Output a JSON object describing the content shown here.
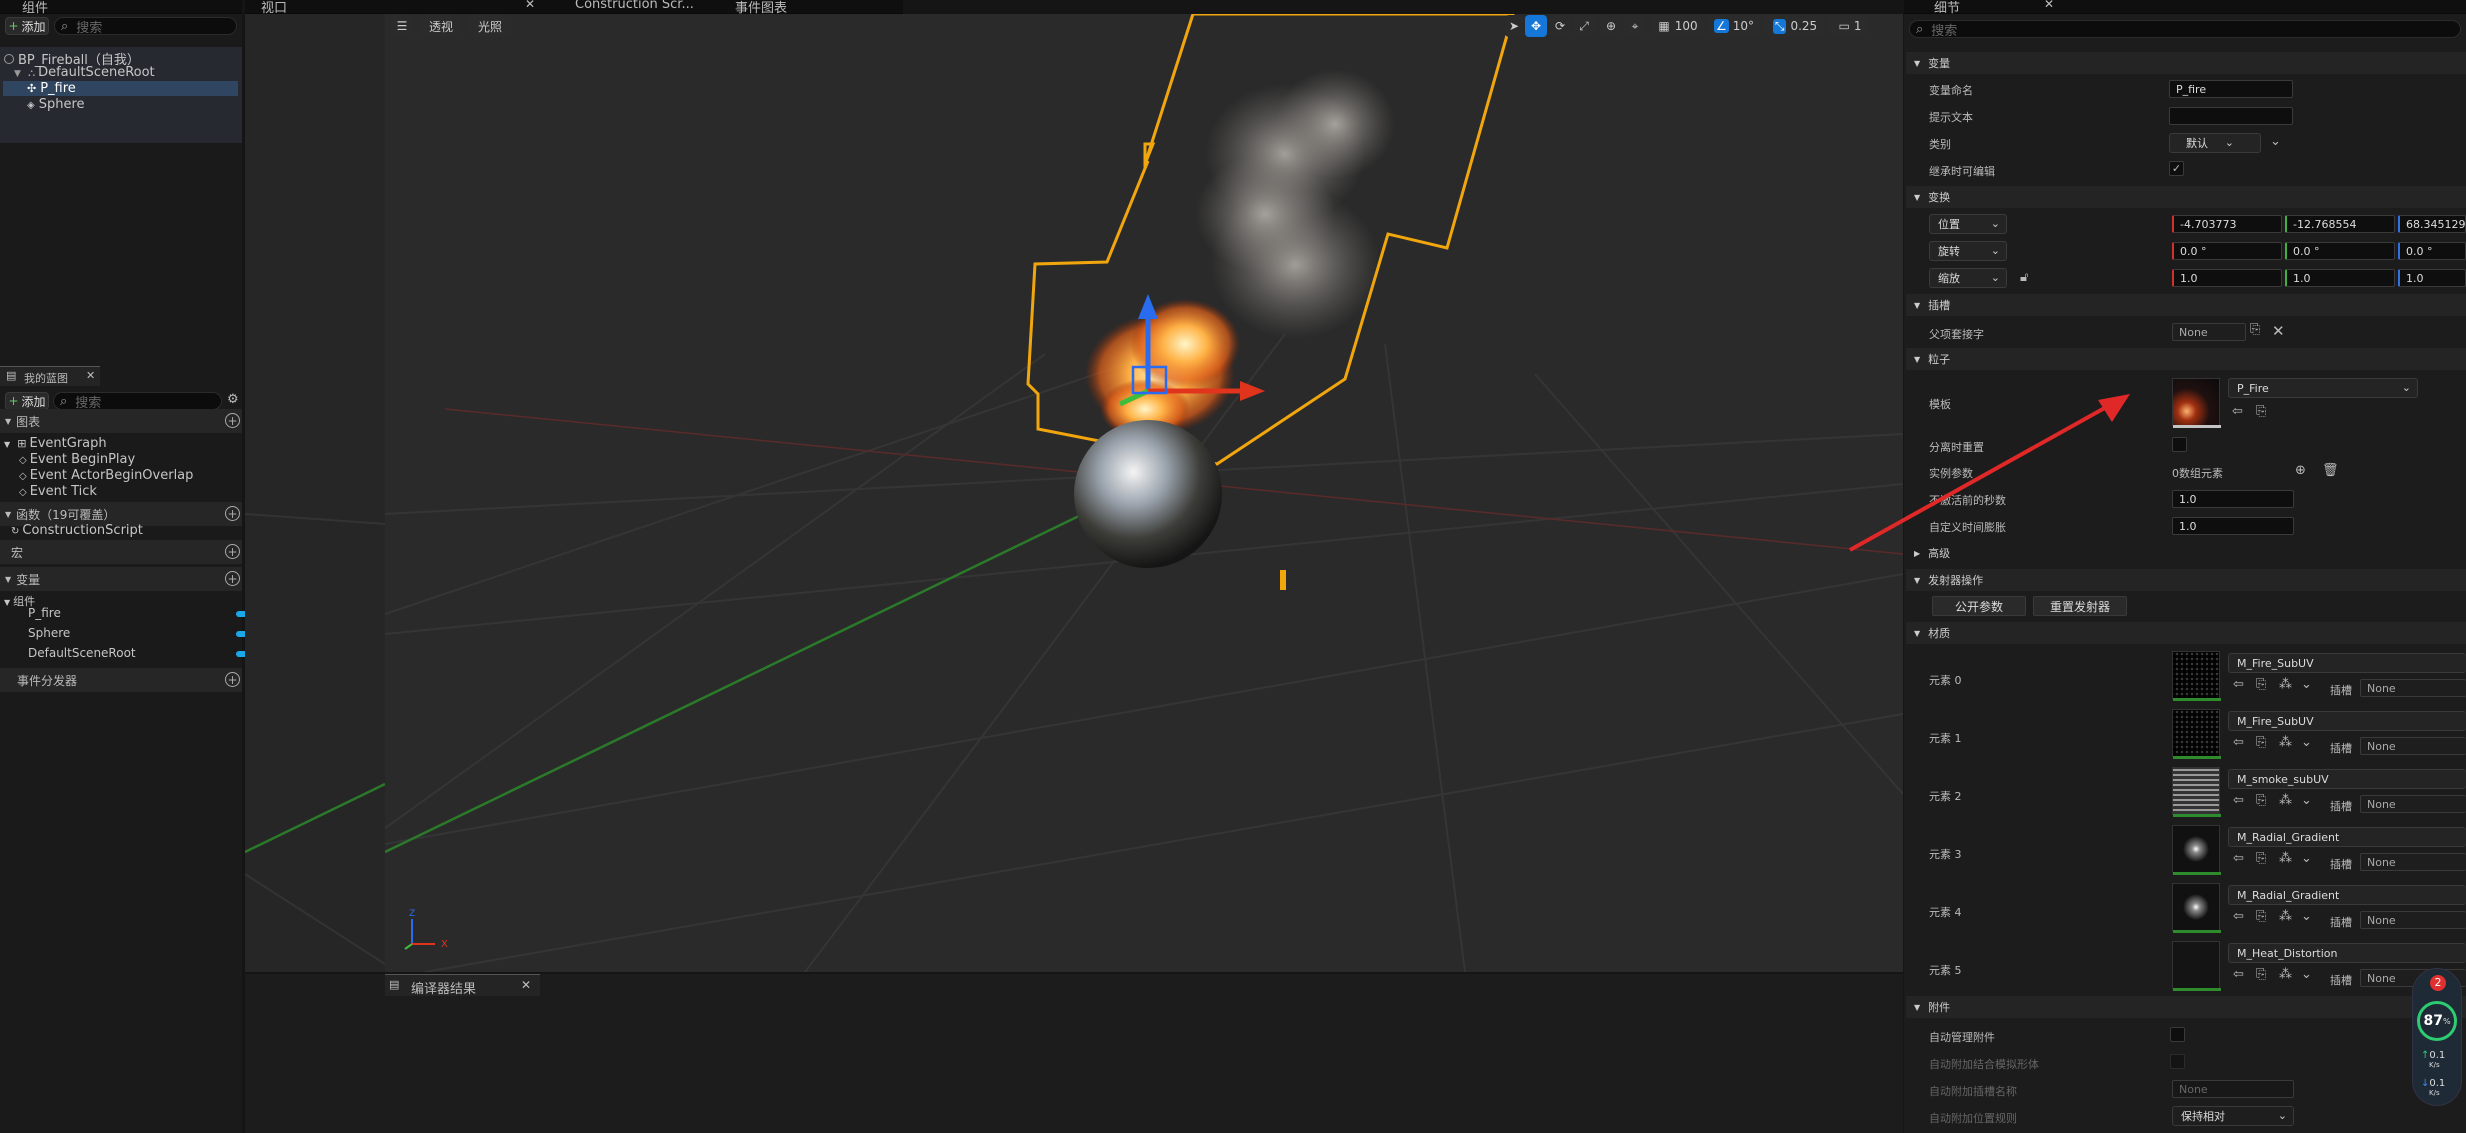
{
  "components_panel": {
    "tab": "组件",
    "add_label": "添加",
    "search_placeholder": "搜索",
    "tree": [
      {
        "label": "BP_Fireball（自我）"
      },
      {
        "label": "DefaultSceneRoot"
      },
      {
        "label": "P_fire"
      },
      {
        "label": "Sphere"
      }
    ]
  },
  "viewport": {
    "tabs": [
      "视口",
      "Construction Scr...",
      "事件图表"
    ],
    "btn_perspective": "透视",
    "btn_lit": "光照",
    "grid_snap": "100",
    "rot_snap": "10°",
    "scale_snap": "0.25",
    "camera_speed": "1",
    "axis_x": "X",
    "axis_z": "Z"
  },
  "my_blueprint": {
    "tab": "我的蓝图",
    "add_label": "添加",
    "search_placeholder": "搜索",
    "graphs_header": "图表",
    "event_graph": "EventGraph",
    "events": [
      "Event BeginPlay",
      "Event ActorBeginOverlap",
      "Event Tick"
    ],
    "functions_header": "函数（19可覆盖）",
    "construction_script": "ConstructionScript",
    "macros_header": "宏",
    "variables_header": "变量",
    "components_sub": "组件",
    "variables": [
      "P_fire",
      "Sphere",
      "DefaultSceneRoot"
    ],
    "dispatchers_header": "事件分发器"
  },
  "compiler": {
    "tab": "编译器结果"
  },
  "details": {
    "tab": "细节",
    "search_placeholder": "搜索",
    "sec_variable": "变量",
    "var_name_label": "变量命名",
    "var_name_value": "P_fire",
    "tooltip_label": "提示文本",
    "category_label": "类别",
    "category_value": "默认",
    "editable_label": "继承时可编辑",
    "sec_transform": "变换",
    "location_label": "位置",
    "location": [
      "-4.703773",
      "-12.768554",
      "68.345129"
    ],
    "rotation_label": "旋转",
    "rotation": [
      "0.0 °",
      "0.0 °",
      "0.0 °"
    ],
    "scale_label": "缩放",
    "scale": [
      "1.0",
      "1.0",
      "1.0"
    ],
    "sec_sockets": "插槽",
    "parent_socket_label": "父项套接字",
    "parent_socket_value": "None",
    "sec_particles": "粒子",
    "template_label": "模板",
    "template_value": "P_Fire",
    "reset_detach_label": "分离时重置",
    "instance_params_label": "实例参数",
    "instance_params_value": "0数组元素",
    "secs_before_inactive_label": "不激活前的秒数",
    "secs_before_inactive_value": "1.0",
    "custom_time_dilation_label": "自定义时间膨胀",
    "custom_time_dilation_value": "1.0",
    "sec_advanced": "高级",
    "sec_emitter_ops": "发射器操作",
    "btn_expose_params": "公开参数",
    "btn_reset_emitters": "重置发射器",
    "sec_materials": "材质",
    "slot_label": "插槽",
    "slot_value": "None",
    "materials": [
      {
        "label": "元素 0",
        "value": "M_Fire_SubUV"
      },
      {
        "label": "元素 1",
        "value": "M_Fire_SubUV"
      },
      {
        "label": "元素 2",
        "value": "M_smoke_subUV"
      },
      {
        "label": "元素 3",
        "value": "M_Radial_Gradient"
      },
      {
        "label": "元素 4",
        "value": "M_Radial_Gradient"
      },
      {
        "label": "元素 5",
        "value": "M_Heat_Distortion"
      }
    ],
    "sec_attachment": "附件",
    "auto_manage_attach_label": "自动管理附件",
    "auto_attach_sim_label": "自动附加结合模拟形体",
    "auto_attach_socket_label": "自动附加插槽名称",
    "auto_attach_socket_value": "None",
    "auto_attach_loc_rule_label": "自动附加位置规则",
    "auto_attach_loc_rule_value": "保持相对"
  },
  "overlay": {
    "badge": "2",
    "percent": "87",
    "percent_unit": "%",
    "up_value": "0.1",
    "up_unit": "K/s",
    "down_value": "0.1",
    "down_unit": "K/s"
  }
}
